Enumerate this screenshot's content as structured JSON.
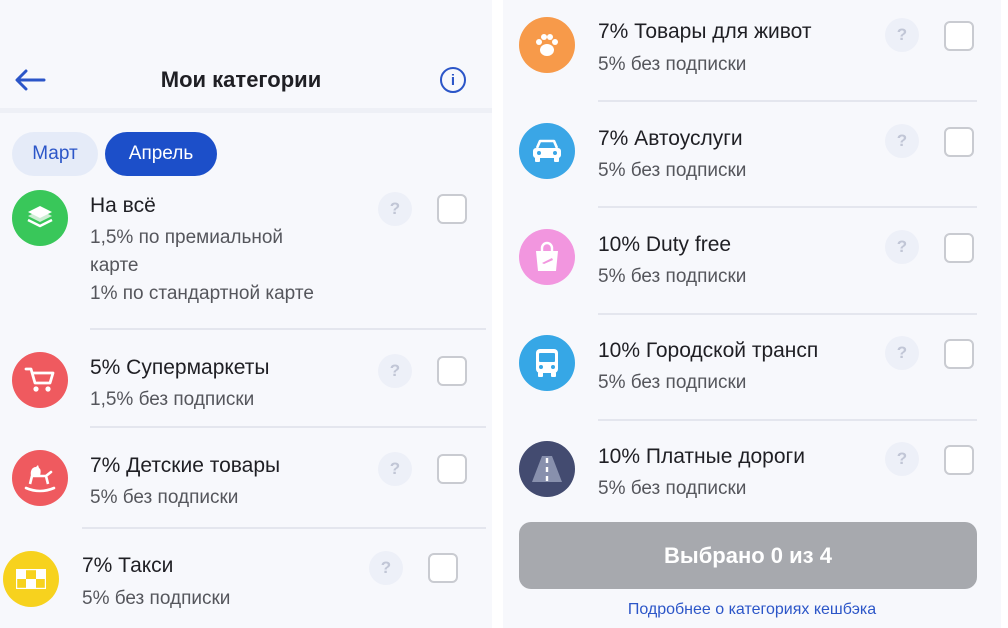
{
  "header": {
    "title": "Мои категории",
    "back_icon": "arrow-left-icon",
    "info_icon": "info-icon",
    "info_symbol": "i"
  },
  "tabs": [
    {
      "label": "Март",
      "active": false
    },
    {
      "label": "Апрель",
      "active": true
    }
  ],
  "left_categories": [
    {
      "icon": "layers-icon",
      "color": "#39c75a",
      "title": "На всё",
      "subtitle_lines": [
        "1,5% по премиальной",
        "карте",
        "1% по стандартной карте"
      ],
      "help": "?",
      "checked": false
    },
    {
      "icon": "cart-icon",
      "color": "#ef5a5f",
      "title": "5% Супермаркеты",
      "subtitle_lines": [
        "1,5% без подписки"
      ],
      "help": "?",
      "checked": false
    },
    {
      "icon": "rocking-horse-icon",
      "color": "#ef5a5f",
      "title": "7% Детские товары",
      "subtitle_lines": [
        "5% без подписки"
      ],
      "help": "?",
      "checked": false
    },
    {
      "icon": "taxi-checker-icon",
      "color": "#f7d21e",
      "title": "7% Такси",
      "subtitle_lines": [
        "5% без подписки"
      ],
      "help": "?",
      "checked": false
    }
  ],
  "right_categories": [
    {
      "icon": "paw-icon",
      "color": "#f79a4a",
      "title": "7% Товары для живот",
      "subtitle": "5% без подписки",
      "help": "?",
      "checked": false
    },
    {
      "icon": "car-icon",
      "color": "#3aa6e6",
      "title": "7% Автоуслуги",
      "subtitle": "5% без подписки",
      "help": "?",
      "checked": false
    },
    {
      "icon": "shopping-bag-icon",
      "color": "#f296df",
      "title": "10% Duty free",
      "subtitle": "5% без подписки",
      "help": "?",
      "checked": false
    },
    {
      "icon": "bus-icon",
      "color": "#36a7e6",
      "title": "10% Городской трансп",
      "subtitle": "5% без подписки",
      "help": "?",
      "checked": false
    },
    {
      "icon": "road-icon",
      "color": "#434b70",
      "title": "10% Платные дороги",
      "subtitle": "5% без подписки",
      "help": "?",
      "checked": false
    }
  ],
  "footer": {
    "button_label": "Выбрано 0 из 4",
    "link_label": "Подробнее о категориях кешбэка"
  }
}
